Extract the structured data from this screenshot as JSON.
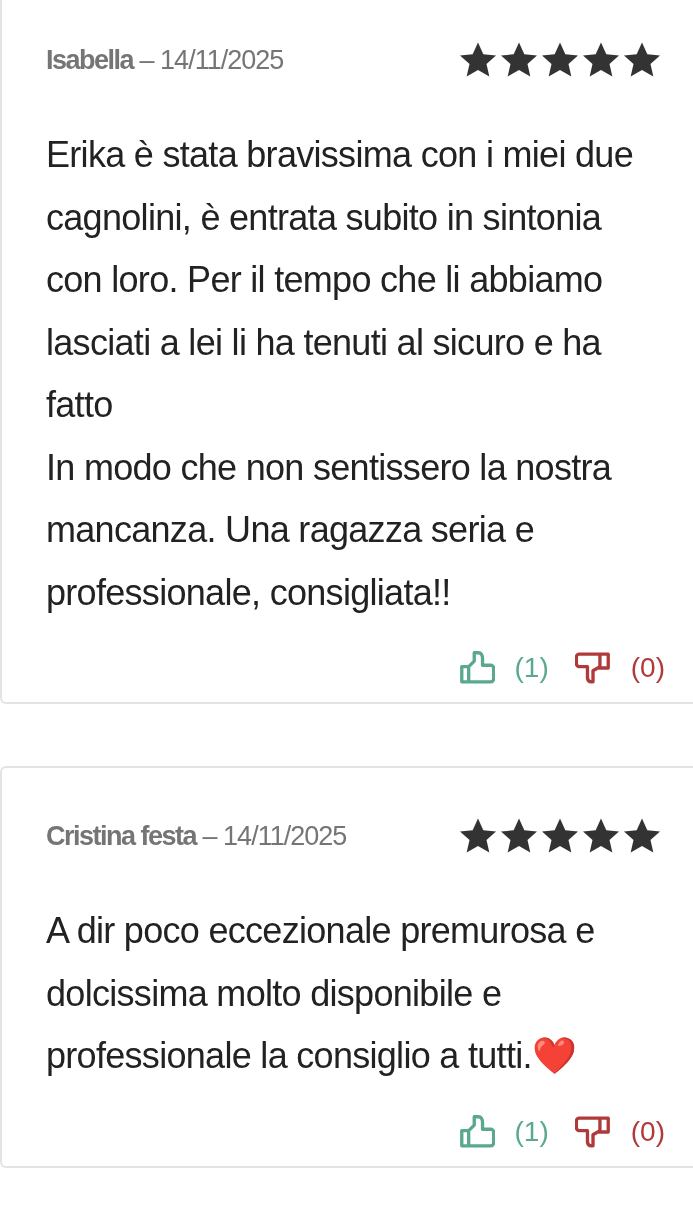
{
  "reviews": [
    {
      "author": "Isabella",
      "date": "– 14/11/2025",
      "stars": 5,
      "text": "Erika è stata bravissima con i miei due cagnolini, è entrata subito in sintonia con loro. Per il tempo che li abbiamo lasciati a lei li ha tenuti al sicuro e ha fatto\nIn modo che non sentissero la nostra mancanza. Una ragazza seria e professionale, consigliata!!",
      "likes": "(1)",
      "dislikes": "(0)"
    },
    {
      "author": "Cristina festa",
      "date": "– 14/11/2025",
      "stars": 5,
      "text": "A dir poco eccezionale premurosa e dolcissima molto disponibile e professionale la consiglio a tutti.❤️",
      "likes": "(1)",
      "dislikes": "(0)"
    }
  ]
}
